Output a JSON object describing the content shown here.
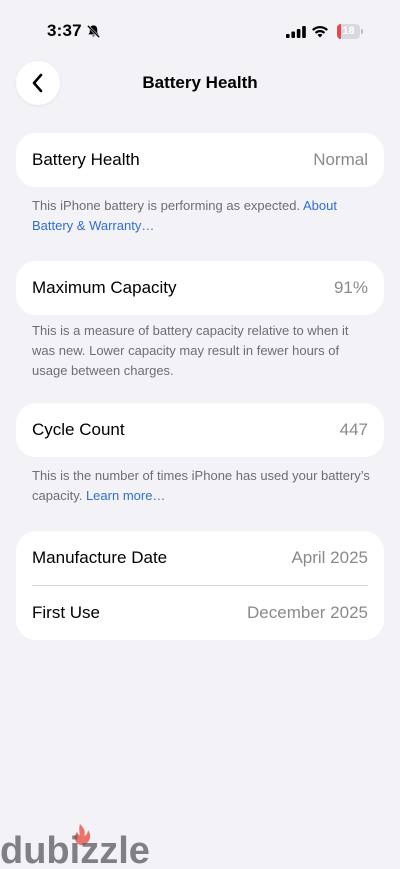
{
  "status_bar": {
    "time": "3:37",
    "battery_level": 18,
    "icons": [
      "bell-slash-icon",
      "cellular-signal-icon",
      "wifi-icon",
      "battery-icon"
    ],
    "battery_color": "#e5484d"
  },
  "nav": {
    "back_icon": "chevron-left-icon",
    "title": "Battery Health"
  },
  "health": {
    "label": "Battery Health",
    "value": "Normal",
    "footer_text": "This iPhone battery is performing as expected. ",
    "footer_link": "About Battery & Warranty…"
  },
  "capacity": {
    "label": "Maximum Capacity",
    "value": "91%",
    "footer_text": "This is a measure of battery capacity relative to when it was new. Lower capacity may result in fewer hours of usage between charges."
  },
  "cycles": {
    "label": "Cycle Count",
    "value": "447",
    "footer_text": "This is the number of times iPhone has used your battery’s capacity. ",
    "footer_link": "Learn more…"
  },
  "dates": {
    "manufacture_label": "Manufacture Date",
    "manufacture_value": "April 2025",
    "first_use_label": "First Use",
    "first_use_value": "December 2025"
  },
  "watermark": {
    "text": "dubizzle",
    "accent": "#e8463a"
  },
  "colors": {
    "background": "#f2f2f7",
    "link": "#2f6fd0",
    "secondary_text": "#8a8a8e"
  }
}
